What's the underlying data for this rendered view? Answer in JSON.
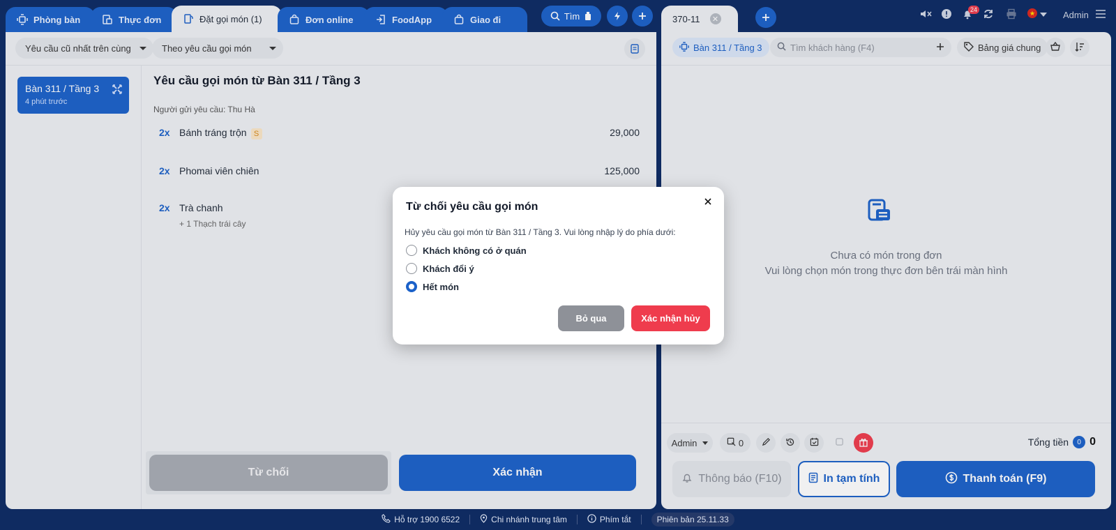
{
  "tabs": [
    {
      "label": "Phòng bàn",
      "icon": "table-icon"
    },
    {
      "label": "Thực đơn",
      "icon": "menu-icon"
    },
    {
      "label": "Đặt gọi món (1)",
      "icon": "order-icon"
    },
    {
      "label": "Đơn online",
      "icon": "bag-icon"
    },
    {
      "label": "FoodApp",
      "icon": "login-icon"
    },
    {
      "label": "Giao đi",
      "icon": "bag-icon"
    }
  ],
  "search_label": "Tìm",
  "filters": {
    "sort": "Yêu cầu cũ nhất trên cùng",
    "group": "Theo yêu cầu gọi món"
  },
  "sidebar": {
    "table_name": "Bàn 311 / Tầng 3",
    "time_ago": "4 phút trước"
  },
  "request": {
    "title": "Yêu cầu gọi món từ Bàn 311 / Tầng 3",
    "sender": "Người gửi yêu cầu: Thu Hà",
    "items": [
      {
        "qty": "2x",
        "name": "Bánh tráng trộn",
        "badge": "S",
        "price": "29,000",
        "topping": ""
      },
      {
        "qty": "2x",
        "name": "Phomai viên chiên",
        "badge": "",
        "price": "125,000",
        "topping": ""
      },
      {
        "qty": "2x",
        "name": "Trà chanh",
        "badge": "",
        "price": "",
        "topping": "+ 1 Thạch trái cây"
      }
    ]
  },
  "actions": {
    "reject": "Từ chối",
    "confirm": "Xác nhận"
  },
  "order_tab": {
    "label": "370-11"
  },
  "topbar": {
    "notification_count": "24",
    "user": "Admin"
  },
  "right_toolbar": {
    "table_chip": "Bàn 311 / Tầng 3",
    "customer_placeholder": "Tìm khách hàng (F4)",
    "price_list": "Bảng giá chung"
  },
  "empty_state": {
    "line1": "Chưa có món trong đơn",
    "line2": "Vui lòng chọn món trong thực đơn bên trái màn hình"
  },
  "right_bottom": {
    "staff": "Admin",
    "guest_count": "0",
    "total_label": "Tổng tiền",
    "total_qty": "0",
    "total_value": "0",
    "notify": "Thông báo (F10)",
    "print": "In tạm tính",
    "pay": "Thanh toán (F9)"
  },
  "modal": {
    "title": "Từ chối yêu cầu gọi món",
    "description": "Hủy yêu cầu gọi món từ Bàn 311 / Tầng 3. Vui lòng nhập lý do phía dưới:",
    "reasons": [
      {
        "label": "Khách không có ở quán",
        "checked": false
      },
      {
        "label": "Khách đổi ý",
        "checked": false
      },
      {
        "label": "Hết món",
        "checked": true
      }
    ],
    "skip": "Bỏ qua",
    "confirm": "Xác nhận hủy"
  },
  "footer": {
    "support": "Hỗ trợ 1900 6522",
    "branch": "Chi nhánh trung tâm",
    "shortcuts": "Phím tắt",
    "version": "Phiên bản 25.11.33"
  },
  "colors": {
    "primary": "#1b61c9",
    "danger": "#ef3c4d",
    "background": "#0b2a63"
  }
}
